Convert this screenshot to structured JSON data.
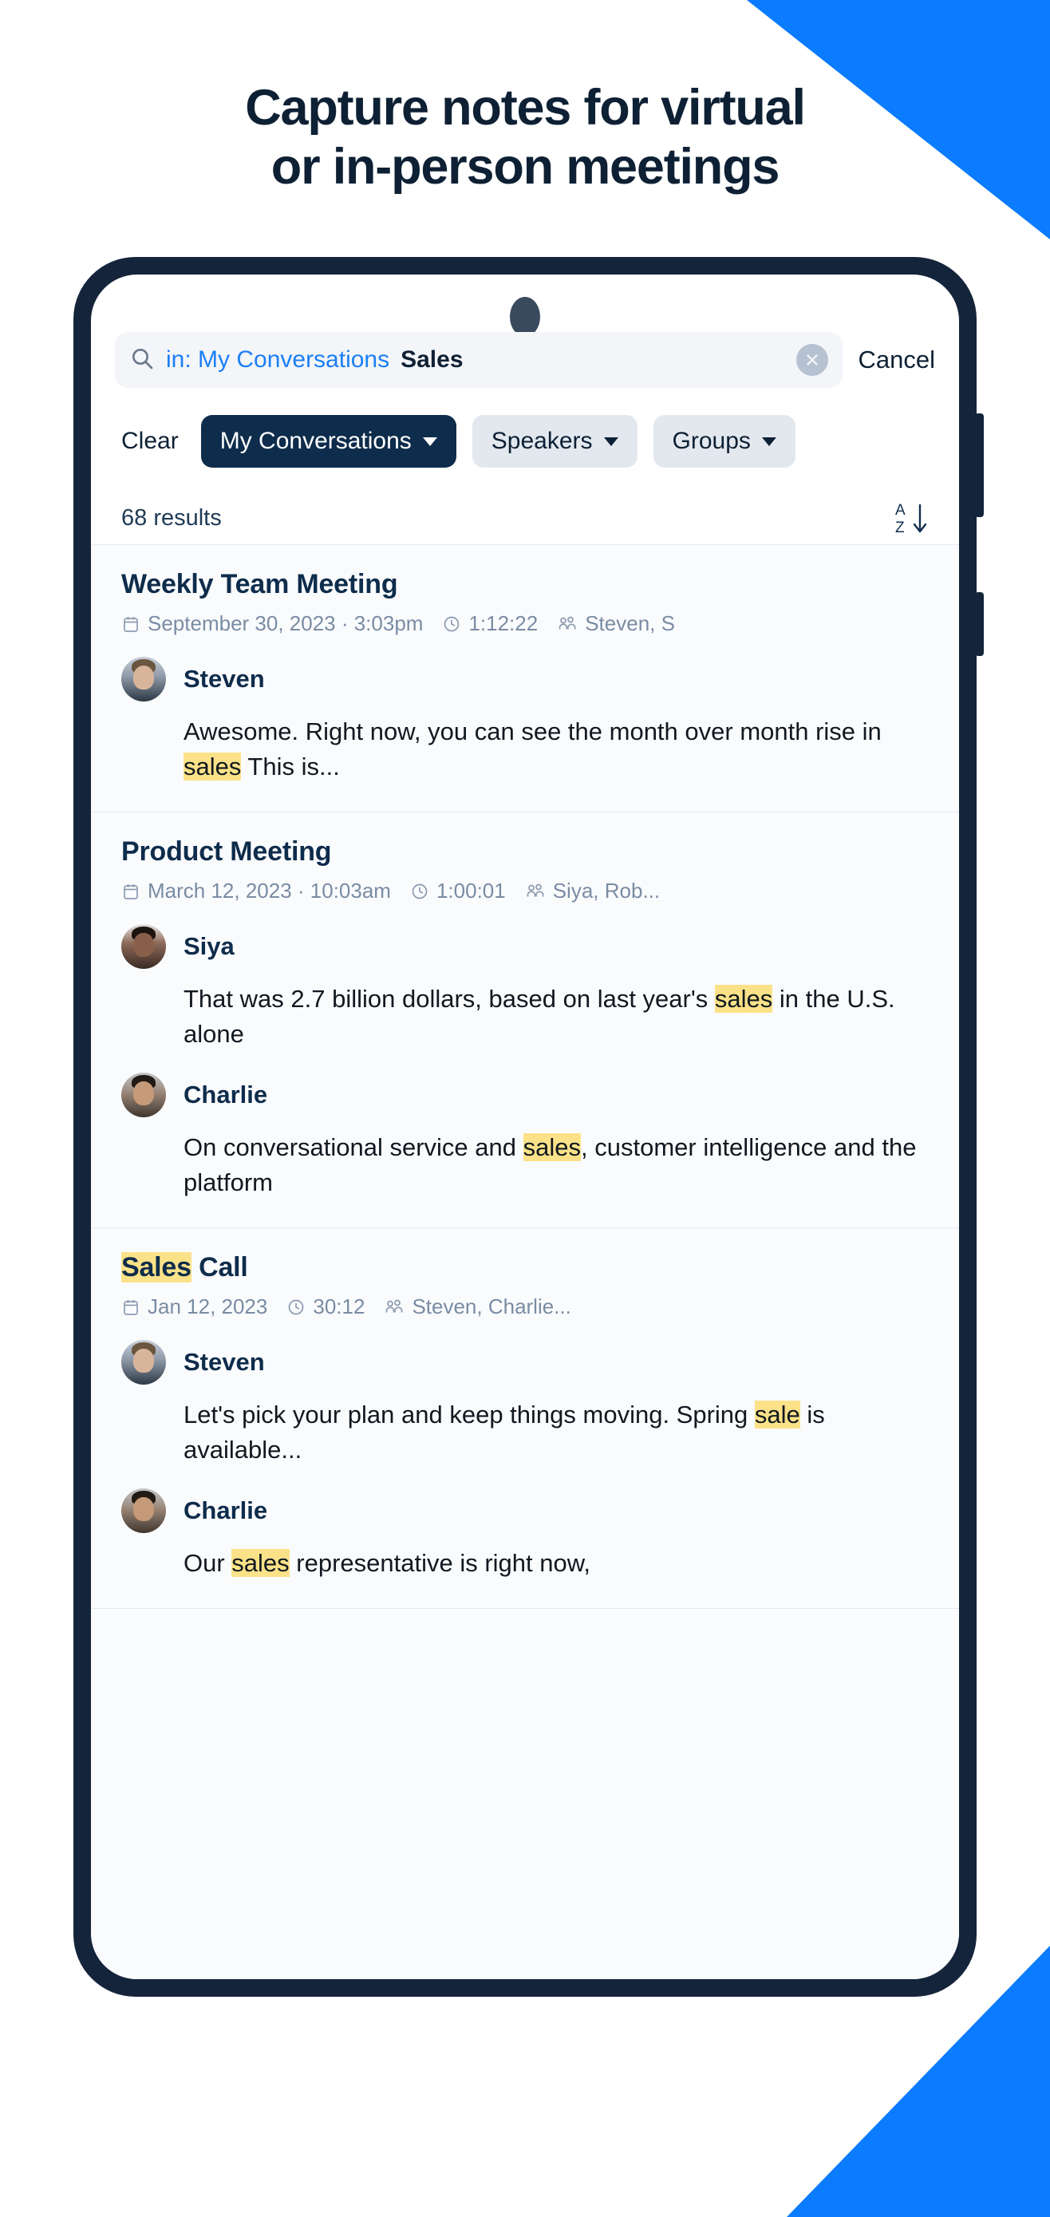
{
  "page": {
    "headline_line1": "Capture notes for virtual",
    "headline_line2": "or in-person meetings",
    "accent_blue": "#0B7BFF",
    "ink": "#0E2034",
    "highlight": "#FBE288"
  },
  "search": {
    "icon": "search-icon",
    "scope_token": "in: My Conversations",
    "query_token": "Sales",
    "clear_icon": "close-circle-icon",
    "cancel_label": "Cancel"
  },
  "filters": {
    "clear_label": "Clear",
    "chips": [
      {
        "label": "My Conversations",
        "active": true
      },
      {
        "label": "Speakers",
        "active": false
      },
      {
        "label": "Groups",
        "active": false
      }
    ]
  },
  "results_meta": {
    "count_label": "68 results",
    "sort_icon": "sort-az-descending-icon",
    "sort_top_letter": "A",
    "sort_bottom_letter": "Z"
  },
  "results": [
    {
      "title_pre": "",
      "title_highlight": "",
      "title_post": "Weekly Team Meeting",
      "date": "September 30, 2023 · 3:03pm",
      "duration": "1:12:22",
      "participants": "Steven, S",
      "utterances": [
        {
          "avatar": "avatar-steven",
          "speaker": "Steven",
          "text_pre": "Awesome. Right now, you can see the month over month rise in ",
          "text_highlight": "sales",
          "text_post": " This is..."
        }
      ]
    },
    {
      "title_pre": "",
      "title_highlight": "",
      "title_post": "Product Meeting",
      "date": "March 12, 2023 · 10:03am",
      "duration": "1:00:01",
      "participants": "Siya, Rob...",
      "utterances": [
        {
          "avatar": "avatar-siya",
          "speaker": "Siya",
          "text_pre": "That was 2.7 billion dollars, based on last year's ",
          "text_highlight": "sales",
          "text_post": " in the U.S. alone"
        },
        {
          "avatar": "avatar-charlie",
          "speaker": "Charlie",
          "text_pre": "On conversational service and ",
          "text_highlight": "sales",
          "text_post": ", customer intelligence and the platform"
        }
      ]
    },
    {
      "title_pre": "",
      "title_highlight": "Sales",
      "title_post": " Call",
      "date": "Jan 12, 2023",
      "duration": "30:12",
      "participants": "Steven, Charlie...",
      "utterances": [
        {
          "avatar": "avatar-steven",
          "speaker": "Steven",
          "text_pre": "Let's pick your plan and keep things moving. Spring ",
          "text_highlight": "sale",
          "text_post": " is available..."
        },
        {
          "avatar": "avatar-charlie",
          "speaker": "Charlie",
          "text_pre": "Our ",
          "text_highlight": "sales",
          "text_post": " representative is right now,"
        }
      ]
    }
  ]
}
